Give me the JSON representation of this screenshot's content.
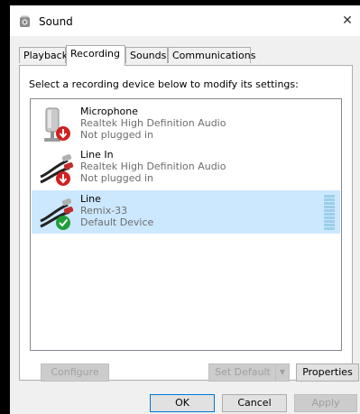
{
  "window": {
    "title": "Sound",
    "close_glyph": "✕"
  },
  "tabs": [
    {
      "label": "Playback"
    },
    {
      "label": "Recording",
      "active": true
    },
    {
      "label": "Sounds"
    },
    {
      "label": "Communications"
    }
  ],
  "panel": {
    "instruction": "Select a recording device below to modify its settings:",
    "devices": [
      {
        "name": "Microphone",
        "driver": "Realtek High Definition Audio",
        "status": "Not plugged in",
        "icon": "microphone-icon",
        "badge": "red-down-arrow"
      },
      {
        "name": "Line In",
        "driver": "Realtek High Definition Audio",
        "status": "Not plugged in",
        "icon": "rca-cable-icon",
        "badge": "red-down-arrow"
      },
      {
        "name": "Line",
        "driver": "Remix-33",
        "status": "Default Device",
        "icon": "rca-cable-icon",
        "badge": "green-check",
        "selected": true
      }
    ],
    "buttons": {
      "configure": "Configure",
      "set_default": "Set Default",
      "properties": "Properties"
    }
  },
  "dialog_buttons": {
    "ok": "OK",
    "cancel": "Cancel",
    "apply": "Apply"
  },
  "colors": {
    "selection": "#cce8ff",
    "accent": "#0078d7",
    "error_badge": "#d21f1f",
    "ok_badge": "#1f9e3a"
  }
}
